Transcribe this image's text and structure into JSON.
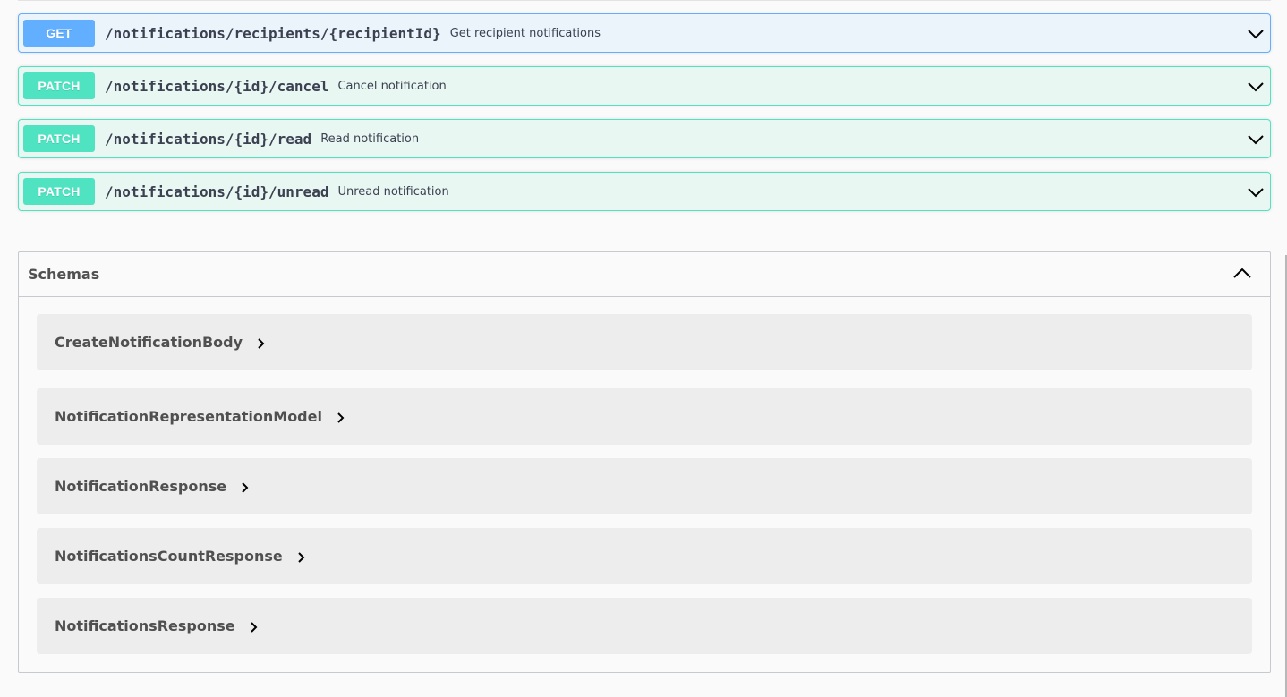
{
  "operations": [
    {
      "method": "GET",
      "kind": "get",
      "path": "/notifications/recipients/{recipientId}",
      "summary": "Get recipient notifications"
    },
    {
      "method": "PATCH",
      "kind": "patch",
      "path": "/notifications/{id}/cancel",
      "summary": "Cancel notification"
    },
    {
      "method": "PATCH",
      "kind": "patch",
      "path": "/notifications/{id}/read",
      "summary": "Read notification"
    },
    {
      "method": "PATCH",
      "kind": "patch",
      "path": "/notifications/{id}/unread",
      "summary": "Unread notification"
    }
  ],
  "schemas": {
    "title": "Schemas",
    "models": [
      {
        "name": "CreateNotificationBody"
      },
      {
        "name": "NotificationRepresentationModel"
      },
      {
        "name": "NotificationResponse"
      },
      {
        "name": "NotificationsCountResponse"
      },
      {
        "name": "NotificationsResponse"
      }
    ]
  },
  "colors": {
    "get": "#61affe",
    "patch": "#50e3c2"
  },
  "icons": {
    "operation_toggle": "chevron-down-icon",
    "schemas_toggle": "chevron-up-icon",
    "model_expand": "chevron-right-icon"
  }
}
